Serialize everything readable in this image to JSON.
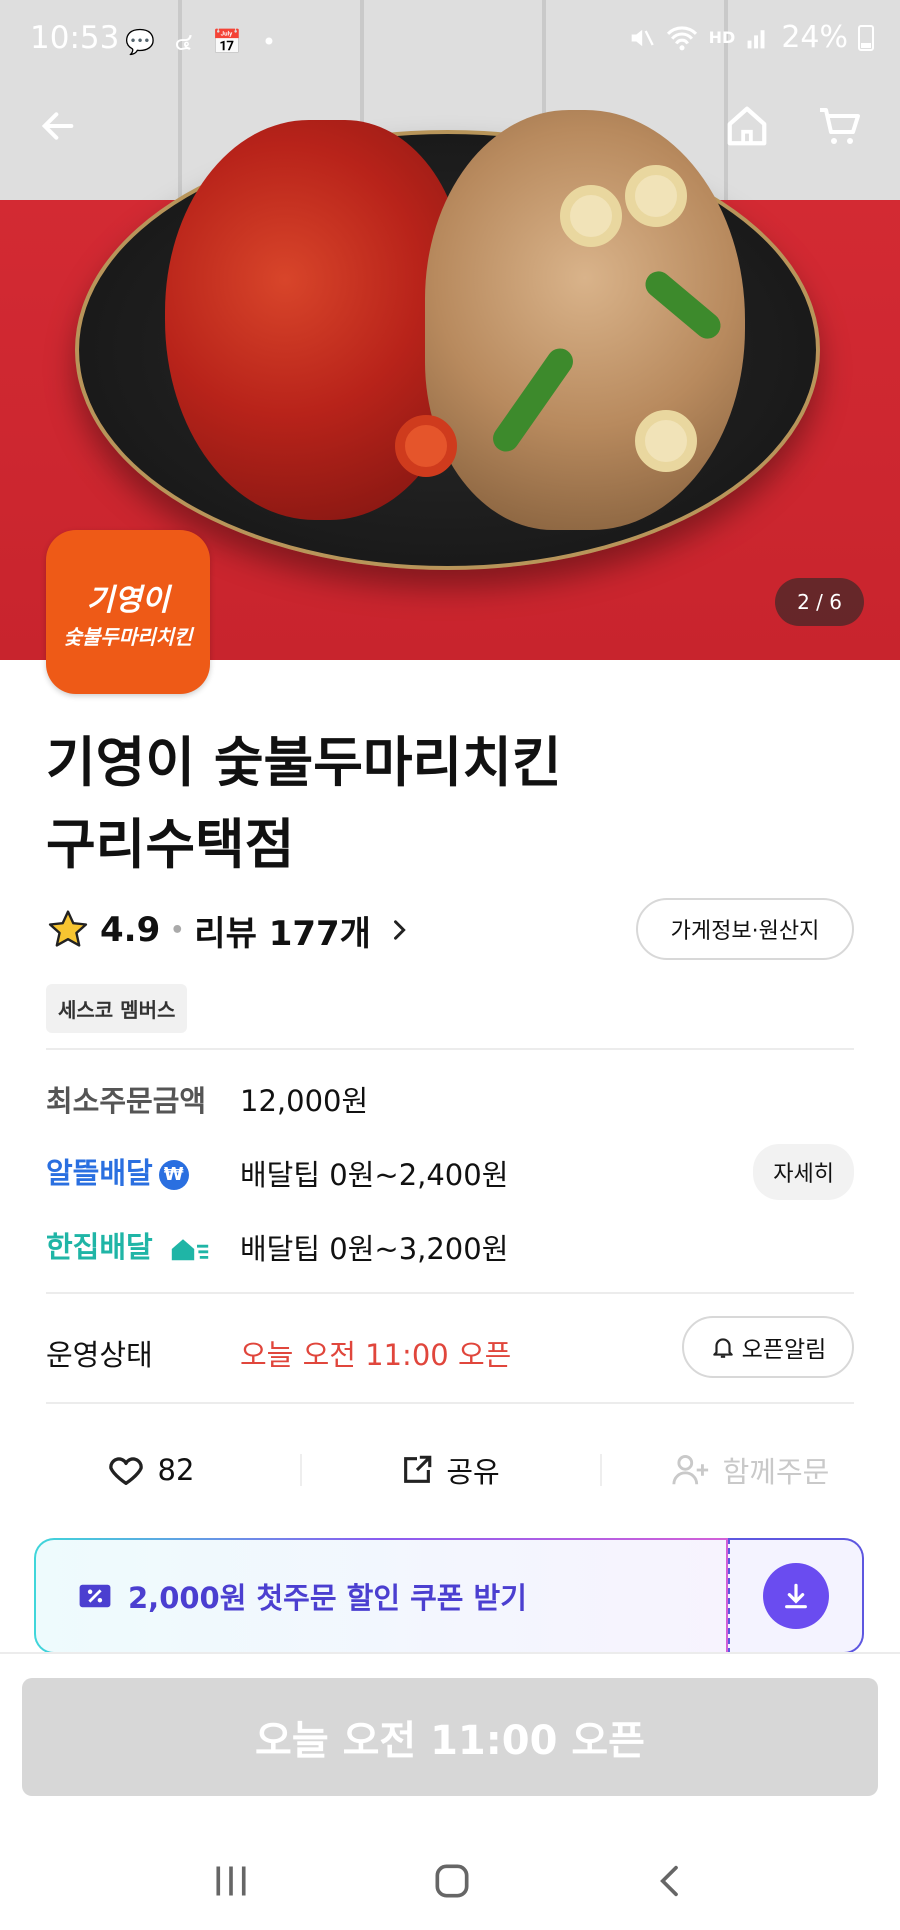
{
  "status_bar": {
    "time": "10:53",
    "left_icons": "💬 ๔ 📅 •",
    "hd": "HD",
    "battery": "24%"
  },
  "hero": {
    "counter": "2 / 6"
  },
  "logo": {
    "line1": "기영이",
    "line2": "숯불두마리치킨"
  },
  "store": {
    "title_line1": "기영이 숯불두마리치킨",
    "title_line2": "구리수택점",
    "rating": "4.9",
    "review_text": "리뷰 177개",
    "info_button": "가게정보·원산지",
    "badge": "세스코 멤버스"
  },
  "delivery": {
    "min_order_label": "최소주문금액",
    "min_order_value": "12,000원",
    "al_label": "알뜰배달",
    "al_value": "배달팁 0원~2,400원",
    "detail_button": "자세히",
    "han_label": "한집배달",
    "han_value": "배달팁 0원~3,200원"
  },
  "operation": {
    "label": "운영상태",
    "value": "오늘 오전 11:00 오픈",
    "alert_button": "오픈알림"
  },
  "actions": {
    "like_count": "82",
    "share_label": "공유",
    "group_label": "함께주문"
  },
  "coupon": {
    "text": "2,000원 첫주문 할인 쿠폰 받기"
  },
  "bottom": {
    "open_button": "오늘 오전 11:00 오픈"
  },
  "colors": {
    "brand_orange": "#ee5a17",
    "status_red": "#e0463c",
    "al_blue": "#2a6fe0",
    "han_teal": "#1fb5a6",
    "coupon_purple": "#4b3fd0"
  }
}
